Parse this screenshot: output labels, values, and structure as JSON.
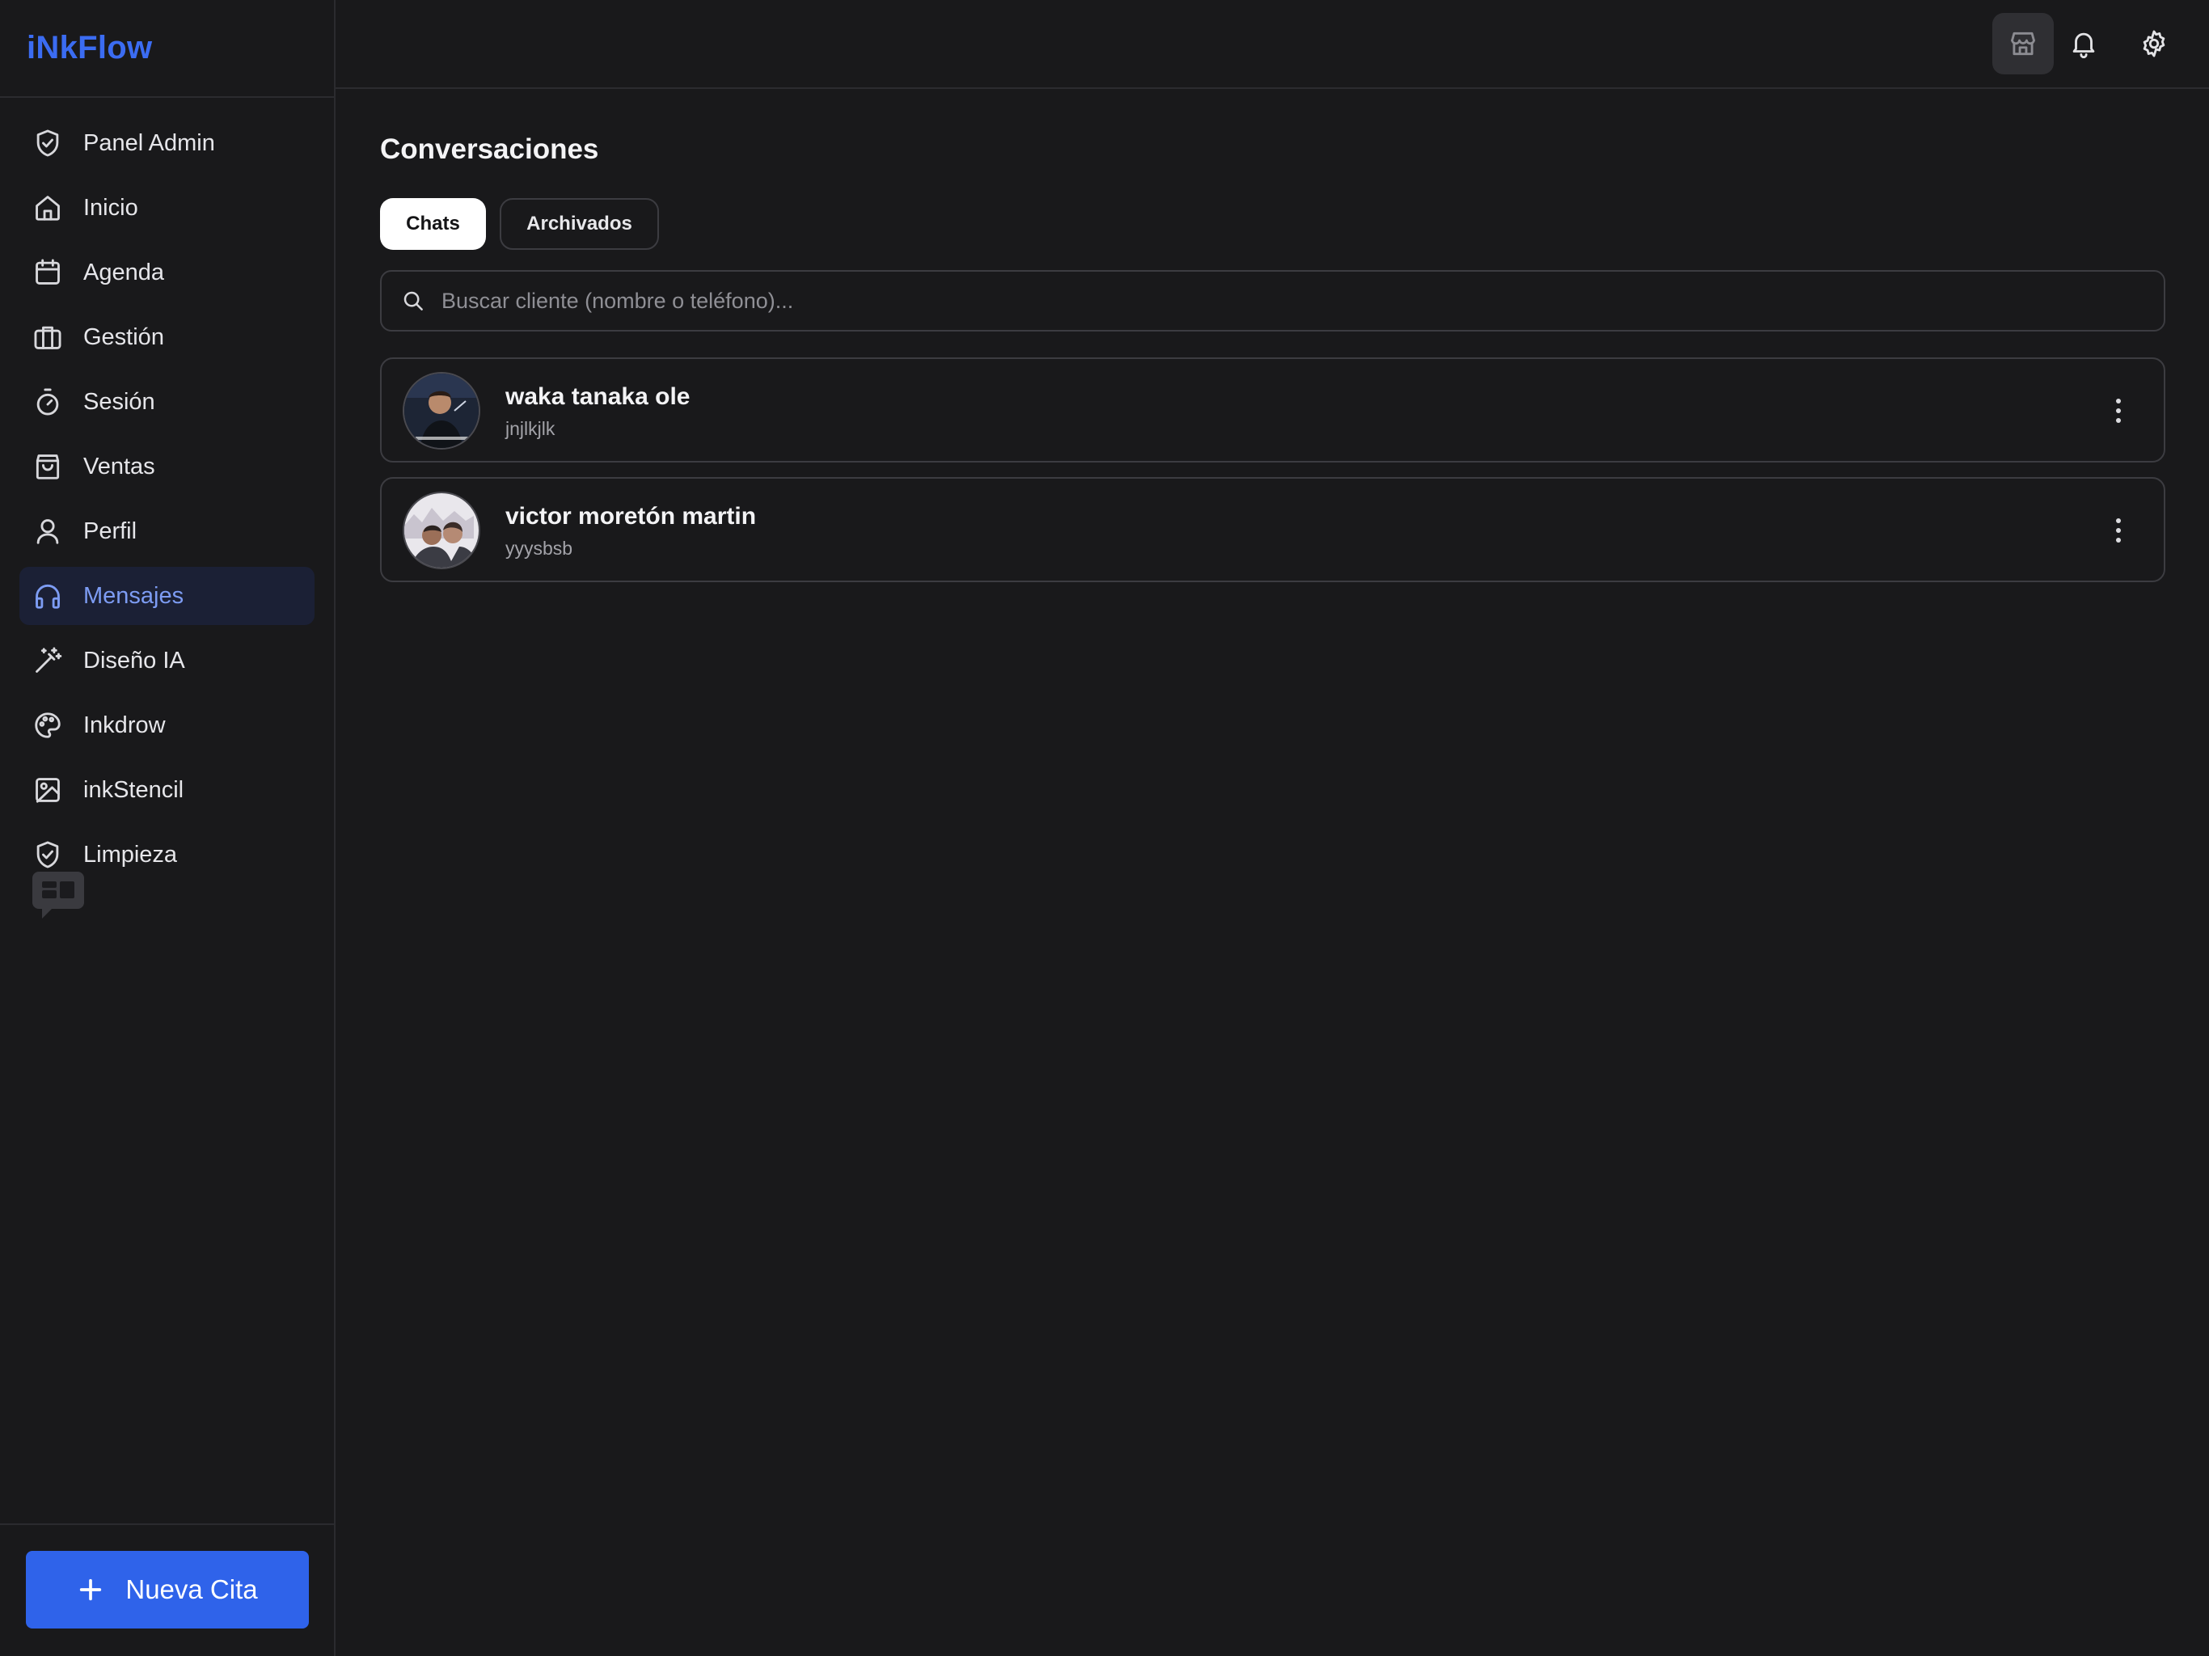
{
  "brand": {
    "name": "iNkFlow",
    "accent_color": "#3b6cf2"
  },
  "sidebar": {
    "items": [
      {
        "label": "Panel Admin",
        "icon": "shield-check-icon"
      },
      {
        "label": "Inicio",
        "icon": "home-icon"
      },
      {
        "label": "Agenda",
        "icon": "calendar-icon"
      },
      {
        "label": "Gestión",
        "icon": "briefcase-icon"
      },
      {
        "label": "Sesión",
        "icon": "stopwatch-icon"
      },
      {
        "label": "Ventas",
        "icon": "shopping-bag-icon"
      },
      {
        "label": "Perfil",
        "icon": "user-icon"
      },
      {
        "label": "Mensajes",
        "icon": "headphones-icon",
        "active": true
      },
      {
        "label": "Diseño IA",
        "icon": "magic-wand-icon"
      },
      {
        "label": "Inkdrow",
        "icon": "palette-icon"
      },
      {
        "label": "inkStencil",
        "icon": "image-icon"
      },
      {
        "label": "Limpieza",
        "icon": "shield-check-icon"
      }
    ],
    "new_appointment_label": "Nueva Cita"
  },
  "topbar": {
    "icons": [
      "store-icon",
      "bell-icon",
      "gear-icon"
    ]
  },
  "main": {
    "title": "Conversaciones",
    "tabs": [
      {
        "label": "Chats",
        "active": true
      },
      {
        "label": "Archivados",
        "active": false
      }
    ],
    "search": {
      "placeholder": "Buscar cliente (nombre o teléfono)...",
      "value": ""
    },
    "chats": [
      {
        "name": "waka tanaka ole",
        "preview": "jnjlkjlk"
      },
      {
        "name": "victor moretón martin",
        "preview": "yyysbsb"
      }
    ]
  }
}
